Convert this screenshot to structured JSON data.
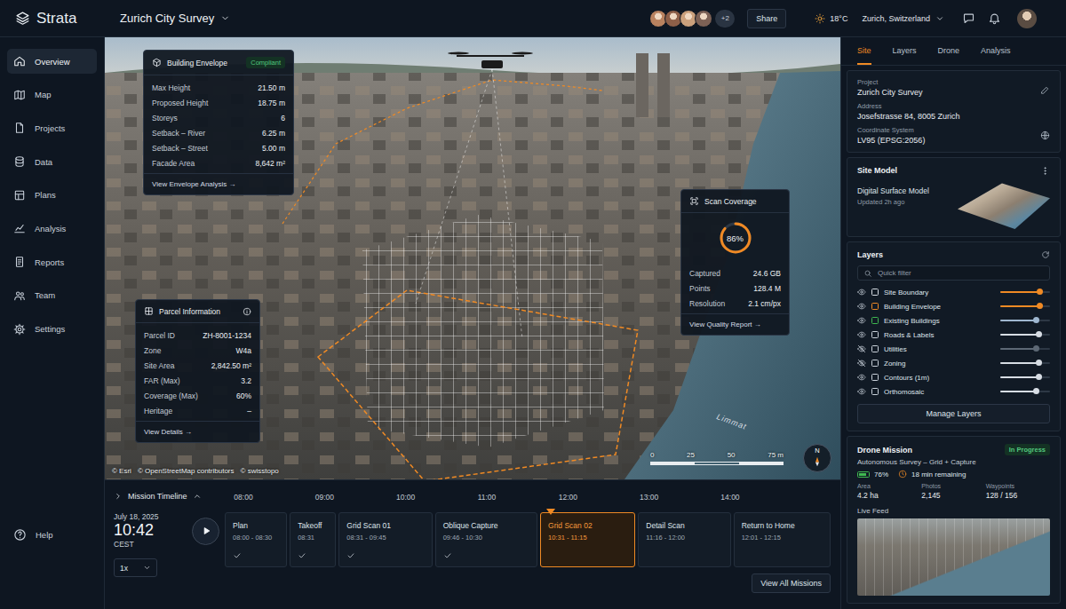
{
  "app": {
    "name": "Strata"
  },
  "header": {
    "project": "Zurich City Survey",
    "collaborators": [
      {
        "color": "#b9825f"
      },
      {
        "color": "#8e5f48"
      },
      {
        "color": "#caa07c"
      },
      {
        "color": "#7d6155"
      }
    ],
    "collaborators_more": "+2",
    "share": "Share",
    "temperature": "18°C",
    "location": "Zurich, Switzerland"
  },
  "sidebar": {
    "items": [
      {
        "label": "Overview",
        "selected": true
      },
      {
        "label": "Map",
        "selected": false
      },
      {
        "label": "Projects",
        "selected": false
      },
      {
        "label": "Data",
        "selected": false
      },
      {
        "label": "Plans",
        "selected": false
      },
      {
        "label": "Analysis",
        "selected": false
      },
      {
        "label": "Reports",
        "selected": false
      },
      {
        "label": "Team",
        "selected": false
      },
      {
        "label": "Settings",
        "selected": false
      }
    ],
    "help": "Help"
  },
  "map": {
    "attribution": [
      "© Esri",
      "© OpenStreetMap contributors",
      "© swisstopo"
    ],
    "river": "Limmat",
    "scale": [
      "0",
      "25",
      "50",
      "75 m"
    ],
    "compass": "N"
  },
  "envelope": {
    "title": "Building Envelope",
    "badge": "Compliant",
    "rows": [
      {
        "label": "Max Height",
        "value": "21.50 m"
      },
      {
        "label": "Proposed Height",
        "value": "18.75 m"
      },
      {
        "label": "Storeys",
        "value": "6"
      },
      {
        "label": "Setback – River",
        "value": "6.25 m"
      },
      {
        "label": "Setback – Street",
        "value": "5.00 m"
      },
      {
        "label": "Facade Area",
        "value": "8,642 m²"
      }
    ],
    "link": "View Envelope Analysis →"
  },
  "parcel": {
    "title": "Parcel Information",
    "rows": [
      {
        "label": "Parcel ID",
        "value": "ZH-8001-1234"
      },
      {
        "label": "Zone",
        "value": "W4a"
      },
      {
        "label": "Site Area",
        "value": "2,842.50 m²"
      },
      {
        "label": "FAR (Max)",
        "value": "3.2"
      },
      {
        "label": "Coverage (Max)",
        "value": "60%"
      },
      {
        "label": "Heritage",
        "value": "–"
      }
    ],
    "link": "View Details →"
  },
  "coverage": {
    "title": "Scan Coverage",
    "percent": "86%",
    "level": 0.86,
    "rows": [
      {
        "label": "Captured",
        "value": "24.6 GB"
      },
      {
        "label": "Points",
        "value": "128.4 M"
      },
      {
        "label": "Resolution",
        "value": "2.1 cm/px"
      }
    ],
    "link": "View Quality Report →"
  },
  "timeline": {
    "title": "Mission Timeline",
    "date": "July 18, 2025",
    "time": "10:42",
    "timezone": "CEST",
    "speed": "1x",
    "hours": [
      "08:00",
      "09:00",
      "10:00",
      "11:00",
      "12:00",
      "13:00",
      "14:00"
    ],
    "phases": [
      {
        "name": "Plan",
        "time": "08:00 - 08:30",
        "done": true,
        "selected": false
      },
      {
        "name": "Takeoff",
        "time": "08:31",
        "done": true,
        "selected": false
      },
      {
        "name": "Grid Scan 01",
        "time": "08:31 - 09:45",
        "done": true,
        "selected": false
      },
      {
        "name": "Oblique Capture",
        "time": "09:46 - 10:30",
        "done": true,
        "selected": false
      },
      {
        "name": "Grid Scan 02",
        "time": "10:31 - 11:15",
        "done": false,
        "selected": true
      },
      {
        "name": "Detail Scan",
        "time": "11:16 - 12:00",
        "done": false,
        "selected": false
      },
      {
        "name": "Return to Home",
        "time": "12:01 - 12:15",
        "done": false,
        "selected": false
      }
    ],
    "view_all": "View All Missions"
  },
  "panel": {
    "tabs": [
      {
        "label": "Site",
        "selected": true
      },
      {
        "label": "Layers",
        "selected": false
      },
      {
        "label": "Drone",
        "selected": false
      },
      {
        "label": "Analysis",
        "selected": false
      }
    ],
    "site": {
      "fields": [
        {
          "label": "Project",
          "value": "Zurich City Survey"
        },
        {
          "label": "Address",
          "value": "Josefstrasse 84, 8005 Zurich"
        },
        {
          "label": "Coordinate System",
          "value": "LV95 (EPSG:2056)"
        }
      ]
    },
    "site_model": {
      "title": "Site Model",
      "name": "Digital Surface Model",
      "updated": "Updated 2h ago"
    },
    "layers": {
      "title": "Layers",
      "filter_placeholder": "Quick filter",
      "items": [
        {
          "name": "Site Boundary",
          "visible": true,
          "color": "#d7dde4",
          "level": 0.8,
          "slider_color": "#f08a24"
        },
        {
          "name": "Building Envelope",
          "visible": true,
          "color": "#f08a24",
          "level": 0.8,
          "slider_color": "#f08a24"
        },
        {
          "name": "Existing Buildings",
          "visible": true,
          "color": "#3fb950",
          "level": 0.72,
          "slider_color": "#9fb7d0"
        },
        {
          "name": "Roads & Labels",
          "visible": true,
          "color": "#c9d1da",
          "level": 0.78,
          "slider_color": "#d7dde4"
        },
        {
          "name": "Utilities",
          "visible": false,
          "color": "#c9d1da",
          "level": 0.72,
          "slider_color": "#5d6875"
        },
        {
          "name": "Zoning",
          "visible": false,
          "color": "#c9d1da",
          "level": 0.78,
          "slider_color": "#d7dde4"
        },
        {
          "name": "Contours (1m)",
          "visible": true,
          "color": "#c9d1da",
          "level": 0.78,
          "slider_color": "#d7dde4"
        },
        {
          "name": "Orthomosaic",
          "visible": true,
          "color": "#c9d1da",
          "level": 0.72,
          "slider_color": "#d7dde4"
        }
      ],
      "manage": "Manage Layers"
    },
    "drone": {
      "title": "Drone Mission",
      "status": "In Progress",
      "subtitle": "Autonomous Survey – Grid + Capture",
      "battery": "76%",
      "battery_level": 0.76,
      "remaining": "18 min remaining",
      "stats": [
        {
          "label": "Area",
          "value": "4.2 ha"
        },
        {
          "label": "Photos",
          "value": "2,145"
        },
        {
          "label": "Waypoints",
          "value": "128 / 156"
        }
      ],
      "live_feed": "Live Feed"
    }
  }
}
